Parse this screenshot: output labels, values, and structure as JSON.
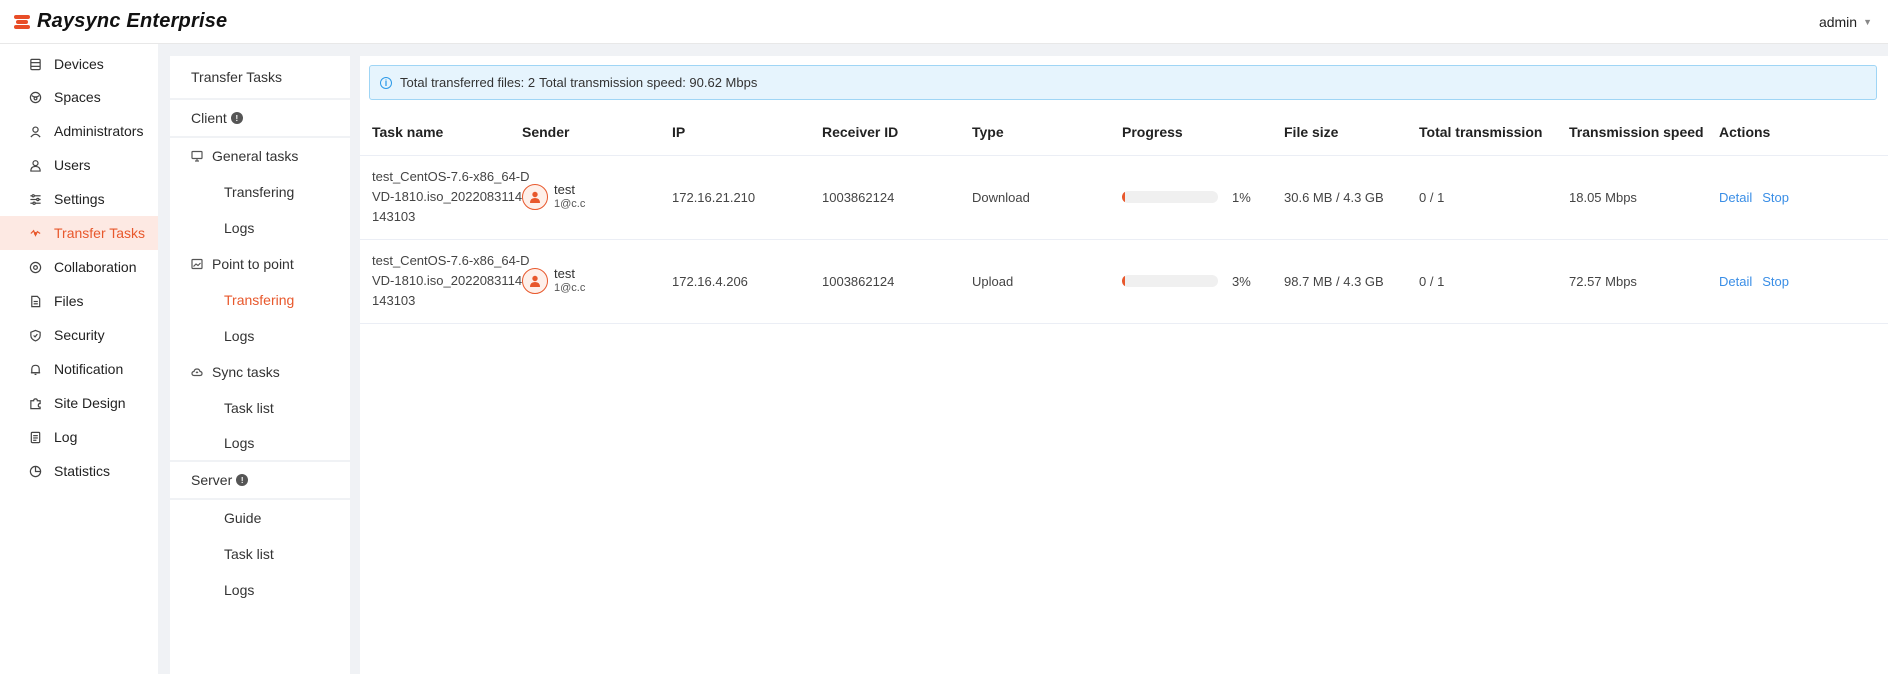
{
  "app": {
    "title": "Raysync Enterprise",
    "user": "admin"
  },
  "sidebar": {
    "items": [
      {
        "label": "Devices",
        "icon": "devices-icon",
        "active": false
      },
      {
        "label": "Spaces",
        "icon": "spaces-icon",
        "active": false
      },
      {
        "label": "Administrators",
        "icon": "administrators-icon",
        "active": false
      },
      {
        "label": "Users",
        "icon": "user-icon",
        "active": false
      },
      {
        "label": "Settings",
        "icon": "settings-icon",
        "active": false
      },
      {
        "label": "Transfer Tasks",
        "icon": "transfer-icon",
        "active": true
      },
      {
        "label": "Collaboration",
        "icon": "collaboration-icon",
        "active": false
      },
      {
        "label": "Files",
        "icon": "file-icon",
        "active": false
      },
      {
        "label": "Security",
        "icon": "shield-icon",
        "active": false
      },
      {
        "label": "Notification",
        "icon": "bell-icon",
        "active": false
      },
      {
        "label": "Site Design",
        "icon": "puzzle-icon",
        "active": false
      },
      {
        "label": "Log",
        "icon": "log-icon",
        "active": false
      },
      {
        "label": "Statistics",
        "icon": "statistics-icon",
        "active": false
      }
    ]
  },
  "submenu": {
    "title": "Transfer Tasks",
    "client_label": "Client",
    "general_label": "General tasks",
    "general_transfering": "Transfering",
    "general_logs": "Logs",
    "p2p_label": "Point to point",
    "p2p_transfering": "Transfering",
    "p2p_logs": "Logs",
    "sync_label": "Sync tasks",
    "sync_task_list": "Task list",
    "sync_logs": "Logs",
    "server_label": "Server",
    "server_guide": "Guide",
    "server_task_list": "Task list",
    "server_logs": "Logs"
  },
  "alert": {
    "files_text": "Total transferred files: 2",
    "speed_text": "Total transmission speed: 90.62 Mbps"
  },
  "table": {
    "headers": {
      "task_name": "Task name",
      "sender": "Sender",
      "ip": "IP",
      "receiver_id": "Receiver ID",
      "type": "Type",
      "progress": "Progress",
      "file_size": "File size",
      "total_transmission": "Total transmission",
      "transmission_speed": "Transmission speed",
      "actions": "Actions"
    },
    "rows": [
      {
        "task_name": "test_CentOS-7.6-x86_64-DVD-1810.iso_20220831144143103",
        "sender_name": "test",
        "sender_email": "1@c.c",
        "ip": "172.16.21.210",
        "receiver_id": "1003862124",
        "type": "Download",
        "progress_value": 1,
        "progress_text": "1%",
        "file_size": "30.6 MB / 4.3 GB",
        "total_transmission": "0 / 1",
        "speed": "18.05 Mbps",
        "detail_label": "Detail",
        "stop_label": "Stop"
      },
      {
        "task_name": "test_CentOS-7.6-x86_64-DVD-1810.iso_20220831144143103",
        "sender_name": "test",
        "sender_email": "1@c.c",
        "ip": "172.16.4.206",
        "receiver_id": "1003862124",
        "type": "Upload",
        "progress_value": 3,
        "progress_text": "3%",
        "file_size": "98.7 MB / 4.3 GB",
        "total_transmission": "0 / 1",
        "speed": "72.57 Mbps",
        "detail_label": "Detail",
        "stop_label": "Stop"
      }
    ]
  },
  "colors": {
    "accent": "#e8582c",
    "link": "#3a8ee6",
    "alert_bg": "#e6f4fd"
  }
}
